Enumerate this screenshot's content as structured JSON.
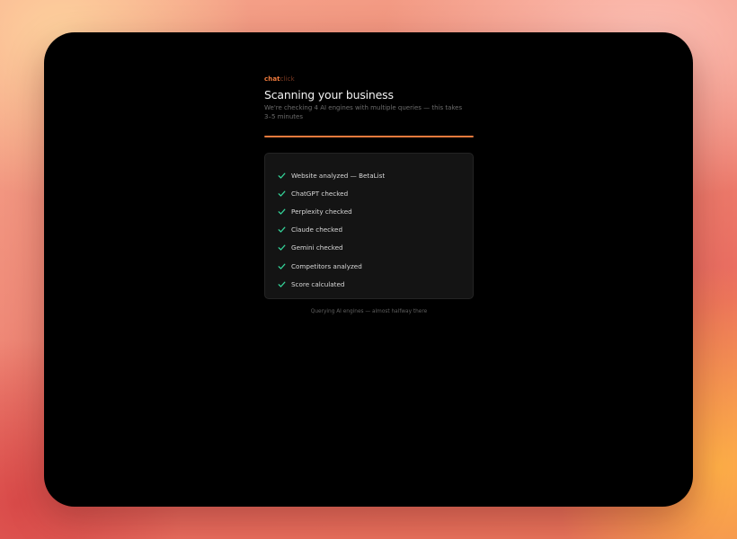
{
  "brand": {
    "part1": "chat",
    "part2": "click",
    "accent": "#f07a3c"
  },
  "header": {
    "title": "Scanning your business",
    "subtitle": "We're checking 4 AI engines with multiple queries — this takes 3–5 minutes"
  },
  "progress": {
    "fraction": 1.0,
    "color": "#f07a3c"
  },
  "steps": [
    {
      "label": "Website analyzed — BetaList",
      "status": "done",
      "icon": "check-icon"
    },
    {
      "label": "ChatGPT checked",
      "status": "done",
      "icon": "check-icon"
    },
    {
      "label": "Perplexity checked",
      "status": "done",
      "icon": "check-icon"
    },
    {
      "label": "Claude checked",
      "status": "done",
      "icon": "check-icon"
    },
    {
      "label": "Gemini checked",
      "status": "done",
      "icon": "check-icon"
    },
    {
      "label": "Competitors analyzed",
      "status": "done",
      "icon": "check-icon"
    },
    {
      "label": "Score calculated",
      "status": "done",
      "icon": "check-icon"
    }
  ],
  "status_text": "Querying AI engines — almost halfway there",
  "colors": {
    "check": "#34d399",
    "window_bg": "#000000",
    "card_bg": "#141414"
  }
}
